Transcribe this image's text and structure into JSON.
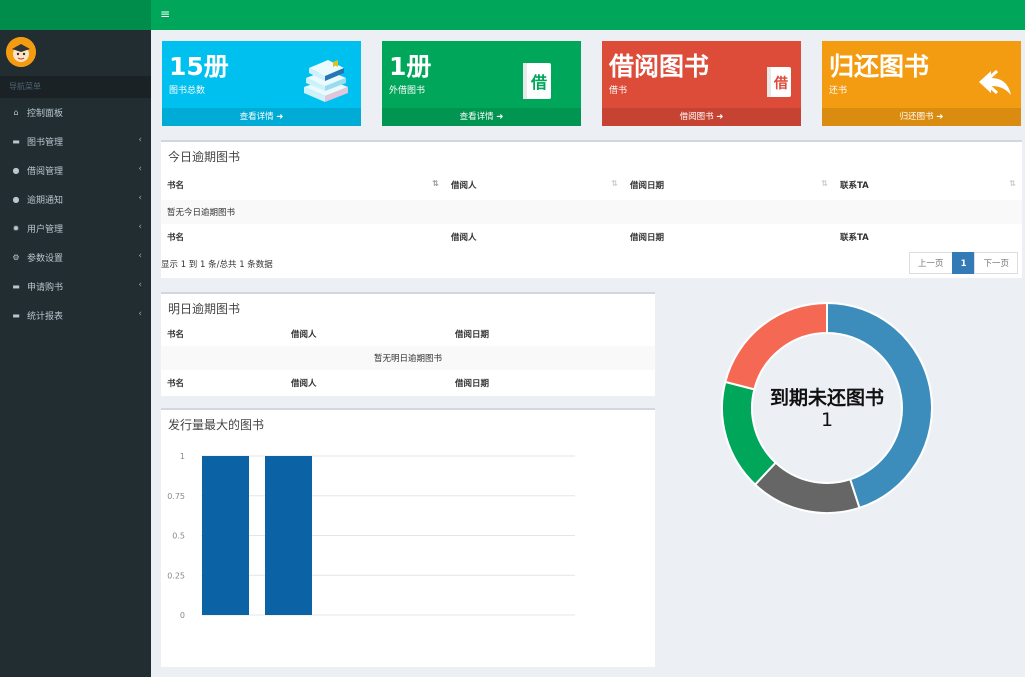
{
  "sidebar": {
    "nav_header": "导航菜单",
    "items": [
      {
        "label": "控制面板",
        "icon": "home-icon",
        "glyph": "⌂",
        "has_children": false
      },
      {
        "label": "图书管理",
        "icon": "book-icon",
        "glyph": "▬",
        "has_children": true
      },
      {
        "label": "借阅管理",
        "icon": "user-icon",
        "glyph": "●",
        "has_children": true
      },
      {
        "label": "逾期通知",
        "icon": "user-icon",
        "glyph": "●",
        "has_children": true
      },
      {
        "label": "用户管理",
        "icon": "gear-icon",
        "glyph": "✹",
        "has_children": true
      },
      {
        "label": "参数设置",
        "icon": "gears-icon",
        "glyph": "⚙",
        "has_children": true
      },
      {
        "label": "申请购书",
        "icon": "book-icon",
        "glyph": "▬",
        "has_children": true
      },
      {
        "label": "统计报表",
        "icon": "book-icon",
        "glyph": "▬",
        "has_children": true
      }
    ],
    "chevron": "‹"
  },
  "header": {
    "menu_toggle": "≡"
  },
  "stats": [
    {
      "number": "15册",
      "label": "图书总数",
      "link": "查看详情",
      "color": "#00c0ef",
      "icon": "books-icon"
    },
    {
      "number": "1册",
      "label": "外借图书",
      "link": "查看详情",
      "color": "#00a65a",
      "icon": "borrow-book-icon",
      "icon_char": "借"
    },
    {
      "number": "借阅图书",
      "label": "借书",
      "link": "借阅图书",
      "color": "#dd4b39",
      "icon": "borrow-book-icon",
      "icon_char": "借"
    },
    {
      "number": "归还图书",
      "label": "还书",
      "link": "归还图书",
      "color": "#f39c12",
      "icon": "return-arrow-icon"
    }
  ],
  "arrow_glyph": "➜",
  "today_overdue": {
    "title": "今日逾期图书",
    "columns": [
      "书名",
      "借阅人",
      "借阅日期",
      "联系TA"
    ],
    "empty": "暂无今日逾期图书",
    "info": "显示 1 到 1 条/总共 1 条数据",
    "pager": {
      "prev": "上一页",
      "current": "1",
      "next": "下一页"
    },
    "sort_glyph": "⇅"
  },
  "tomorrow_overdue": {
    "title": "明日逾期图书",
    "columns": [
      "书名",
      "借阅人",
      "借阅日期"
    ],
    "empty": "暂无明日逾期图书"
  },
  "top_books": {
    "title": "发行量最大的图书"
  },
  "donut": {
    "title": "到期未还图书",
    "value": "1"
  },
  "chart_data": [
    {
      "type": "bar",
      "title": "发行量最大的图书",
      "categories": [
        "",
        ""
      ],
      "values": [
        1,
        1
      ],
      "ylim": [
        0,
        1
      ],
      "yticks": [
        "0",
        "0.25",
        "0.5",
        "0.75",
        "1"
      ],
      "grid": true,
      "colors": [
        "#0b62a4"
      ]
    },
    {
      "type": "pie",
      "title": "到期未还图书",
      "center_value": "1",
      "values": [
        45,
        17,
        17,
        21
      ],
      "colors": [
        "#3c8dbc",
        "#666666",
        "#00a65a",
        "#f56954"
      ]
    }
  ]
}
